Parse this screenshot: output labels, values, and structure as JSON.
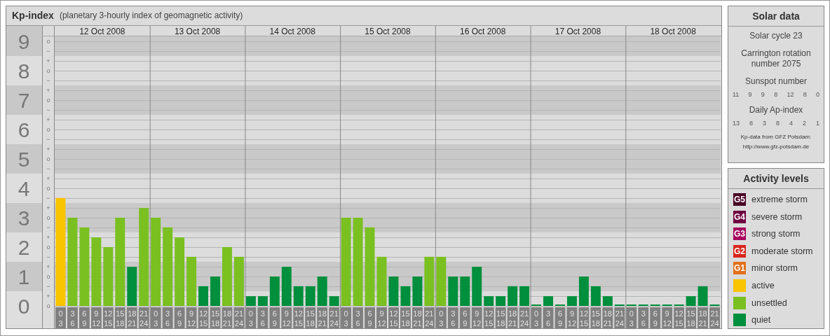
{
  "header": {
    "title": "Kp-index",
    "subtitle": "(planetary 3-hourly index of geomagnetic activity)"
  },
  "days": [
    "12 Oct 2008",
    "13 Oct 2008",
    "14 Oct 2008",
    "15 Oct 2008",
    "16 Oct 2008",
    "17 Oct 2008",
    "18 Oct 2008"
  ],
  "kp_subdivisions": [
    "o",
    "−",
    "+",
    "o",
    "−",
    "+",
    "o",
    "−",
    "+",
    "o",
    "−",
    "+",
    "o",
    "−",
    "+",
    "o",
    "−",
    "+",
    "o",
    "−",
    "+",
    "o",
    "−",
    "+",
    "o",
    "−",
    "+",
    "o"
  ],
  "chart_data": {
    "type": "bar",
    "grid": true,
    "bands": [
      {
        "axis": "y",
        "from": 8.5,
        "to": 9.17
      },
      {
        "axis": "y",
        "from": 6.5,
        "to": 7.5
      },
      {
        "axis": "y",
        "from": 4.5,
        "to": 5.5
      },
      {
        "axis": "y",
        "from": 2.5,
        "to": 3.5
      },
      {
        "axis": "y",
        "from": 0.5,
        "to": 1.5
      }
    ],
    "ylim": [
      0,
      9
    ],
    "yticks": [
      0,
      1,
      2,
      3,
      4,
      5,
      6,
      7,
      8,
      9
    ],
    "categories": [
      "0 3",
      "3 6",
      "6 9",
      "9 12",
      "12 15",
      "15 18",
      "18 21",
      "21 24",
      "0 3",
      "3 6",
      "6 9",
      "9 12",
      "12 15",
      "15 18",
      "18 21",
      "21 24",
      "0 3",
      "3 6",
      "6 9",
      "9 12",
      "12 15",
      "15 18",
      "18 21",
      "21 24",
      "0 3",
      "3 6",
      "6 9",
      "9 12",
      "12 15",
      "15 18",
      "18 21",
      "21 24",
      "0 3",
      "3 6",
      "6 9",
      "9 12",
      "12 15",
      "15 18",
      "18 21",
      "21 24",
      "0 3",
      "3 6",
      "6 9",
      "9 12",
      "12 15",
      "15 18",
      "18 21",
      "21 24",
      "0 3",
      "3 6",
      "6 9",
      "9 12",
      "12 15",
      "15 18",
      "18 21",
      "21 24"
    ],
    "series": [
      {
        "name": "active",
        "color": "#f9c400",
        "values": [
          3.67,
          null,
          null,
          null,
          null,
          null,
          null,
          null,
          null,
          null,
          null,
          null,
          null,
          null,
          null,
          null,
          null,
          null,
          null,
          null,
          null,
          null,
          null,
          null,
          null,
          null,
          null,
          null,
          null,
          null,
          null,
          null,
          null,
          null,
          null,
          null,
          null,
          null,
          null,
          null,
          null,
          null,
          null,
          null,
          null,
          null,
          null,
          null,
          null,
          null,
          null,
          null,
          null,
          null,
          null,
          null
        ]
      },
      {
        "name": "unsettled",
        "color": "#7ac021",
        "values": [
          null,
          3,
          2.67,
          2.33,
          2,
          3,
          null,
          3.33,
          3,
          2.67,
          2.33,
          1.67,
          null,
          null,
          2,
          1.67,
          null,
          null,
          null,
          null,
          null,
          null,
          null,
          null,
          3,
          3,
          2.67,
          1.67,
          null,
          null,
          null,
          1.67,
          1.67,
          null,
          null,
          null,
          null,
          null,
          null,
          null,
          null,
          null,
          null,
          null,
          null,
          null,
          null,
          null,
          null,
          null,
          null,
          null,
          null,
          null,
          null,
          null
        ]
      },
      {
        "name": "quiet",
        "color": "#008f3c",
        "values": [
          null,
          null,
          null,
          null,
          null,
          null,
          1.33,
          null,
          null,
          null,
          null,
          null,
          0.67,
          1,
          null,
          null,
          0.33,
          0.33,
          1,
          1.33,
          0.67,
          0.67,
          1,
          0.33,
          null,
          null,
          null,
          null,
          1,
          0.67,
          1,
          null,
          null,
          1,
          1,
          1.33,
          0.33,
          0.33,
          0.67,
          0.67,
          0,
          0.33,
          0,
          0.33,
          1,
          0.67,
          0.33,
          0,
          0,
          0,
          0,
          0,
          0,
          0.33,
          0.67,
          0
        ]
      }
    ]
  },
  "solar_data": {
    "title": "Solar data",
    "solar_cycle": "Solar cycle 23",
    "carrington": "Carrington rotation number 2075",
    "sunspot_label": "Sunspot number",
    "sunspot_values": [
      "11",
      "9",
      "9",
      "8",
      "12",
      "8",
      "0"
    ],
    "ap_label": "Daily Ap-index",
    "ap_values": [
      "13",
      "8",
      "3",
      "8",
      "4",
      "2",
      "1"
    ],
    "credit": "Kp-data from GFZ Potsdam:",
    "credit_url": "http://www.gfz-potsdam.de"
  },
  "activity_levels": {
    "title": "Activity levels",
    "items": [
      {
        "badge": "G5",
        "label": "extreme storm",
        "color": "#4a0025"
      },
      {
        "badge": "G4",
        "label": "severe storm",
        "color": "#6e0040"
      },
      {
        "badge": "G3",
        "label": "strong storm",
        "color": "#a8005e"
      },
      {
        "badge": "G2",
        "label": "moderate storm",
        "color": "#d8261c"
      },
      {
        "badge": "G1",
        "label": "minor storm",
        "color": "#e5701b"
      }
    ]
  }
}
